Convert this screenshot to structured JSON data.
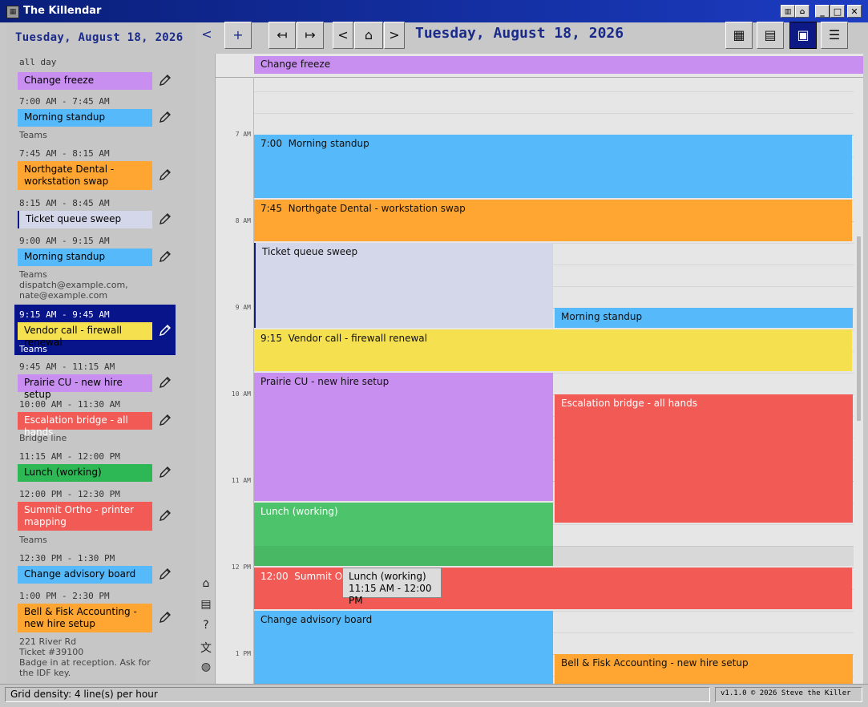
{
  "window": {
    "title": "The Killendar"
  },
  "sidebar": {
    "date": "Tuesday, August 18, 2026",
    "allday_label": "all day",
    "items": [
      {
        "time": "",
        "label": "Change freeze",
        "color": "#c98ff0",
        "meta": ""
      },
      {
        "time": "7:00 AM - 7:45 AM",
        "label": "Morning standup",
        "color": "#56b9f9",
        "meta": "Teams"
      },
      {
        "time": "7:45 AM - 8:15 AM",
        "label": "Northgate Dental - workstation swap",
        "color": "#ffa531",
        "meta": ""
      },
      {
        "time": "8:15 AM - 8:45 AM",
        "label": "Ticket queue sweep",
        "color": "#d4d6e9",
        "meta": ""
      },
      {
        "time": "9:00 AM - 9:15 AM",
        "label": "Morning standup",
        "color": "#56b9f9",
        "meta": "Teams\ndispatch@example.com,\nnate@example.com"
      },
      {
        "time": "9:15 AM - 9:45 AM",
        "label": "Vendor call - firewall renewal",
        "color": "#f5e050",
        "meta": "Teams"
      },
      {
        "time": "9:45 AM - 11:15 AM",
        "label": "Prairie CU - new hire setup",
        "color": "#c98ff0",
        "meta": ""
      },
      {
        "time": "10:00 AM - 11:30 AM",
        "label": "Escalation bridge - all hands",
        "color": "#f25a55",
        "meta": "Bridge line"
      },
      {
        "time": "11:15 AM - 12:00 PM",
        "label": "Lunch (working)",
        "color": "#2eb855",
        "meta": ""
      },
      {
        "time": "12:00 PM - 12:30 PM",
        "label": "Summit Ortho - printer mapping",
        "color": "#f25a55",
        "meta": "Teams"
      },
      {
        "time": "12:30 PM - 1:30 PM",
        "label": "Change advisory board",
        "color": "#56b9f9",
        "meta": ""
      },
      {
        "time": "1:00 PM - 2:30 PM",
        "label": "Bell & Fisk Accounting - new hire setup",
        "color": "#ffa531",
        "meta": "221 River Rd\nTicket #39100\nBadge in at reception. Ask for\nthe IDF key."
      }
    ]
  },
  "header": {
    "date": "Tuesday, August 18, 2026",
    "buttons": {
      "back": "<",
      "add": "+",
      "prev_week": "↤",
      "next_week": "↦",
      "prev_day": "<",
      "today": "⌂",
      "next_day": ">"
    }
  },
  "calendar": {
    "allday_event": "Change freeze",
    "hours": [
      "7 AM",
      "8 AM",
      "9 AM",
      "10 AM",
      "11 AM",
      "12 PM",
      "1 PM"
    ],
    "events": {
      "standup": {
        "time": "7:00",
        "label": "Morning standup"
      },
      "northgate": {
        "time": "7:45",
        "label": "Northgate Dental - workstation swap"
      },
      "ticket": {
        "label": "Ticket queue sweep"
      },
      "standup2": {
        "label": "Morning standup"
      },
      "vendor": {
        "time": "9:15",
        "label": "Vendor call - firewall renewal"
      },
      "prairie": {
        "label": "Prairie CU - new hire setup"
      },
      "escalation": {
        "label": "Escalation bridge - all hands"
      },
      "lunch": {
        "label": "Lunch (working)"
      },
      "summit": {
        "time": "12:00",
        "label": "Summit Ortho"
      },
      "cab": {
        "label": "Change advisory board"
      },
      "bellfisk": {
        "label": "Bell & Fisk Accounting - new hire setup"
      }
    },
    "tooltip": {
      "title": "Lunch (working)",
      "time": "11:15 AM - 12:00 PM"
    }
  },
  "status": {
    "left": "Grid density: 4 line(s) per hour",
    "right": "v1.1.0  © 2026  Steve the Killer"
  }
}
